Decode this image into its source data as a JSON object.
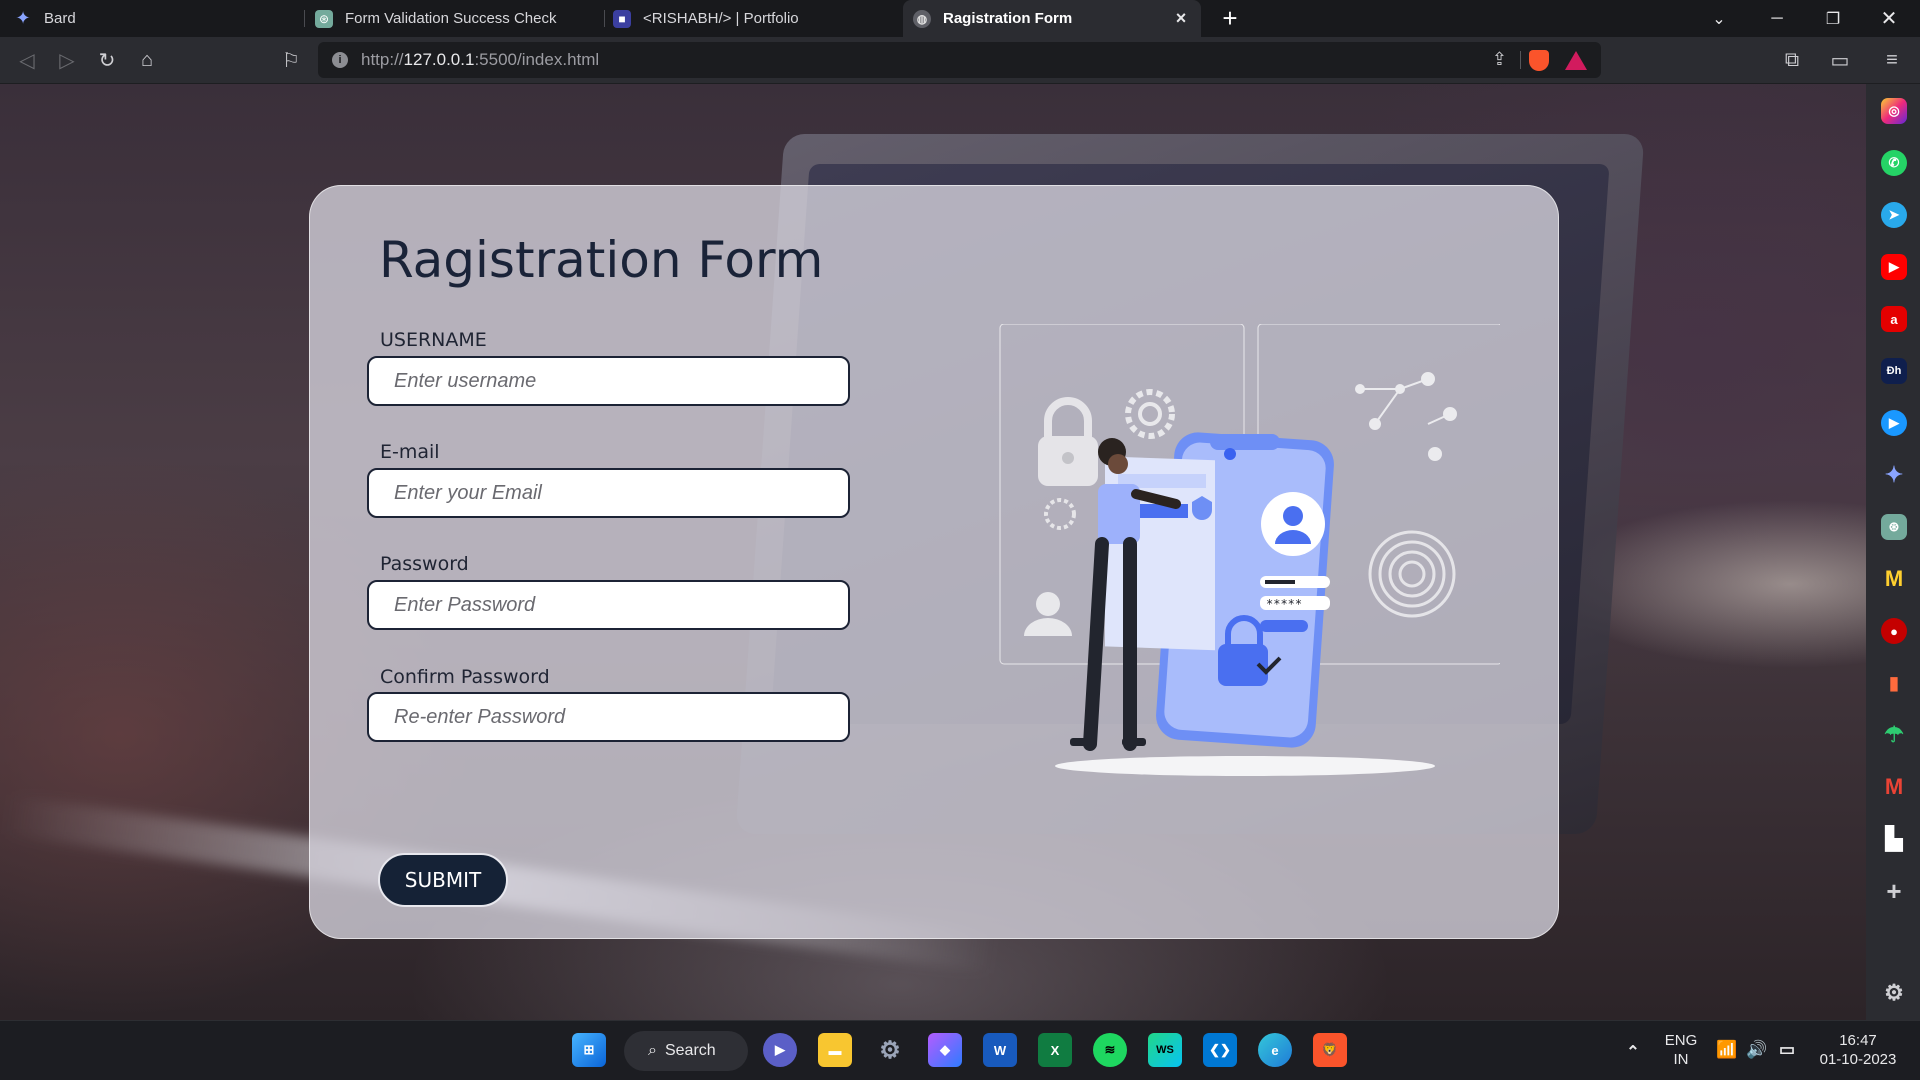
{
  "browser": {
    "tabs": [
      {
        "label": "Bard",
        "icon": "sparkle-icon",
        "active": false
      },
      {
        "label": "Form Validation Success Check",
        "icon": "chatgpt-icon",
        "active": false
      },
      {
        "label": "<RISHABH/> | Portfolio",
        "icon": "portfolio-icon",
        "active": false
      },
      {
        "label": "Ragistration Form",
        "icon": "globe-icon",
        "active": true
      }
    ],
    "url_prefix": "http://",
    "url_host": "127.0.0.1",
    "url_rest": ":5500/index.html"
  },
  "form": {
    "title": "Ragistration Form",
    "fields": [
      {
        "label": "USERNAME",
        "placeholder": "Enter username"
      },
      {
        "label": "E-mail",
        "placeholder": "Enter your Email"
      },
      {
        "label": "Password",
        "placeholder": "Enter Password"
      },
      {
        "label": "Confirm Password",
        "placeholder": "Re-enter Password"
      }
    ],
    "submit_label": "SUBMIT",
    "illustration_password_mask": "*****"
  },
  "sidebar": {
    "apps": [
      "instagram",
      "whatsapp",
      "telegram",
      "youtube",
      "airtel",
      "hotstar",
      "prime-video",
      "bard",
      "chatgpt",
      "miro",
      "anime",
      "stats",
      "umbrella",
      "gmail",
      "unsplash"
    ]
  },
  "taskbar": {
    "search_label": "Search",
    "language": "ENG",
    "region": "IN",
    "time": "16:47",
    "date": "01-10-2023"
  },
  "colors": {
    "card_text": "#1a2338",
    "submit_bg": "#152236",
    "illustration_blue": "#6e8ff5"
  }
}
